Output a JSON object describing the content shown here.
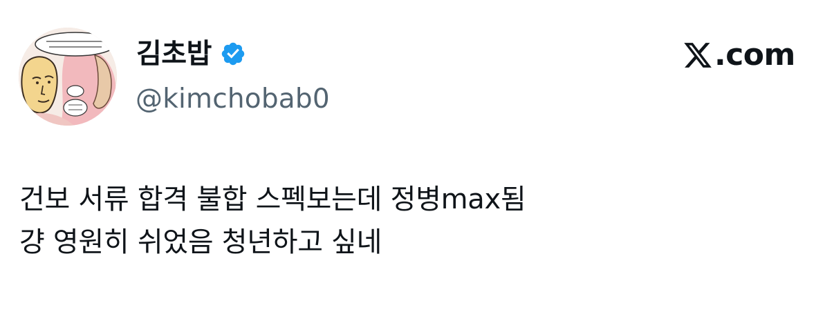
{
  "author": {
    "display_name": "김초밥",
    "handle": "@kimchobab0",
    "verified": true,
    "avatar_icon": "comic-character-avatar-icon",
    "verified_color": "#1d9bf0"
  },
  "brand": {
    "icon": "x-logo-icon",
    "label": ".com"
  },
  "tweet": {
    "lines": [
      "건보 서류 합격 불합 스펙보는데 정병max됨",
      "걍 영원히 쉬었음 청년하고 싶네"
    ]
  },
  "colors": {
    "text": "#0f1419",
    "secondary_text": "#536471",
    "background": "#ffffff"
  }
}
